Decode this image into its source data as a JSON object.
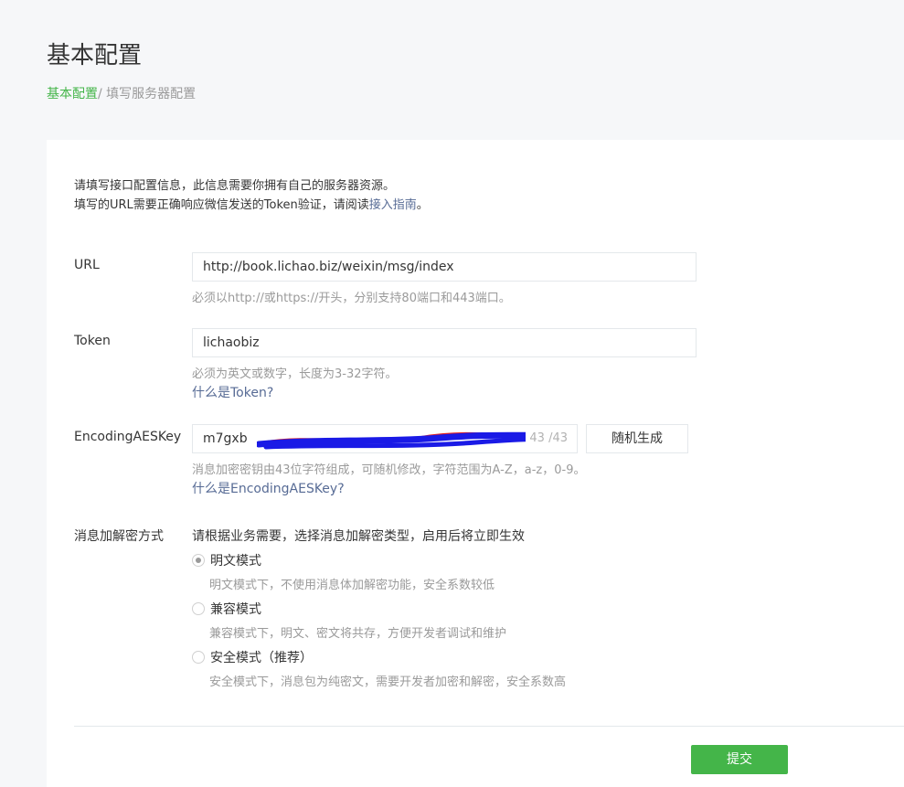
{
  "header": {
    "title": "基本配置",
    "breadcrumb_link": "基本配置",
    "breadcrumb_sep": "/ ",
    "breadcrumb_current": "填写服务器配置"
  },
  "intro": {
    "line1": "请填写接口配置信息，此信息需要你拥有自己的服务器资源。",
    "line2_prefix": "填写的URL需要正确响应微信发送的Token验证，请阅读",
    "line2_link": "接入指南",
    "line2_suffix": "。"
  },
  "url": {
    "label": "URL",
    "value": "http://book.lichao.biz/weixin/msg/index",
    "hint": "必须以http://或https://开头，分别支持80端口和443端口。"
  },
  "token": {
    "label": "Token",
    "value": "lichaobiz",
    "hint": "必须为英文或数字，长度为3-32字符。",
    "help_link": "什么是Token?"
  },
  "aeskey": {
    "label": "EncodingAESKey",
    "value_visible": "m7gxb",
    "counter": "43 /43",
    "random_button": "随机生成",
    "hint": "消息加密密钥由43位字符组成，可随机修改，字符范围为A-Z，a-z，0-9。",
    "help_link": "什么是EncodingAESKey?"
  },
  "encryption": {
    "label": "消息加解密方式",
    "description": "请根据业务需要，选择消息加解密类型，启用后将立即生效",
    "options": [
      {
        "label": "明文模式",
        "desc": "明文模式下，不使用消息体加解密功能，安全系数较低",
        "checked": true
      },
      {
        "label": "兼容模式",
        "desc": "兼容模式下，明文、密文将共存，方便开发者调试和维护",
        "checked": false
      },
      {
        "label": "安全模式（推荐）",
        "desc": "安全模式下，消息包为纯密文，需要开发者加密和解密，安全系数高",
        "checked": false
      }
    ]
  },
  "submit_label": "提交",
  "colors": {
    "accent_green": "#44b549",
    "link_blue": "#576b95",
    "scribble_blue": "#1a1ae6",
    "scribble_red": "#e02020"
  }
}
